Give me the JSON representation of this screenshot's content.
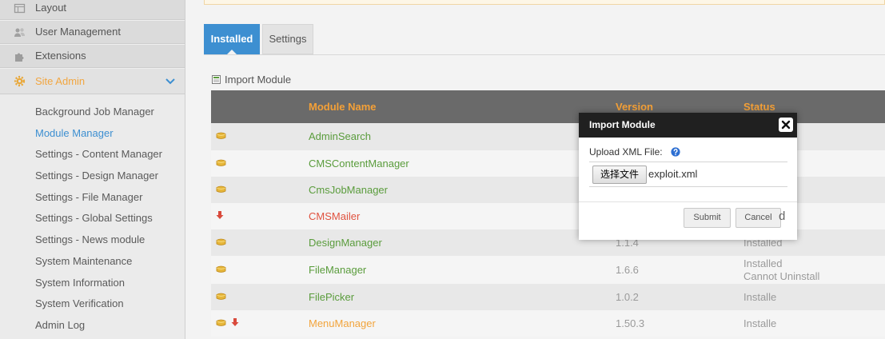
{
  "sidebar": {
    "nav": [
      {
        "label": "Layout",
        "icon": "layout-icon"
      },
      {
        "label": "User Management",
        "icon": "users-icon"
      },
      {
        "label": "Extensions",
        "icon": "puzzle-icon"
      },
      {
        "label": "Site Admin",
        "icon": "gear-icon",
        "expanded": true
      }
    ],
    "submenu": [
      {
        "label": "Background Job Manager",
        "active": false
      },
      {
        "label": "Module Manager",
        "active": true
      },
      {
        "label": "Settings - Content Manager",
        "active": false
      },
      {
        "label": "Settings - Design Manager",
        "active": false
      },
      {
        "label": "Settings - File Manager",
        "active": false
      },
      {
        "label": "Settings - Global Settings",
        "active": false
      },
      {
        "label": "Settings - News module",
        "active": false
      },
      {
        "label": "System Maintenance",
        "active": false
      },
      {
        "label": "System Information",
        "active": false
      },
      {
        "label": "System Verification",
        "active": false
      },
      {
        "label": "Admin Log",
        "active": false
      }
    ]
  },
  "tabs": [
    {
      "label": "Installed",
      "active": true
    },
    {
      "label": "Settings",
      "active": false
    }
  ],
  "import_link": {
    "label": "Import Module",
    "icon": "import-icon"
  },
  "table": {
    "headers": {
      "name": "Module Name",
      "version": "Version",
      "status": "Status"
    },
    "rows": [
      {
        "icons": [
          "package-icon"
        ],
        "name": "AdminSearch",
        "name_color": "#5a9c3c"
      },
      {
        "icons": [
          "package-icon"
        ],
        "name": "CMSContentManager",
        "name_color": "#5a9c3c"
      },
      {
        "icons": [
          "package-icon"
        ],
        "name": "CmsJobManager",
        "name_color": "#5a9c3c"
      },
      {
        "icons": [
          "down-arrow-icon"
        ],
        "name": "CMSMailer",
        "name_color": "#e0523f",
        "status": [
          "d"
        ]
      },
      {
        "icons": [
          "package-icon"
        ],
        "name": "DesignManager",
        "name_color": "#5a9c3c",
        "version": "1.1.4",
        "status": [
          "Installed"
        ]
      },
      {
        "icons": [
          "package-icon"
        ],
        "name": "FileManager",
        "name_color": "#5a9c3c",
        "version": "1.6.6",
        "status": [
          "Installed",
          "Cannot Uninstall"
        ]
      },
      {
        "icons": [
          "package-icon"
        ],
        "name": "FilePicker",
        "name_color": "#5a9c3c",
        "version": "1.0.2",
        "status": [
          "Installe"
        ]
      },
      {
        "icons": [
          "package-icon",
          "down-arrow-icon"
        ],
        "name": "MenuManager",
        "name_color": "#f2a43c",
        "version": "1.50.3",
        "status": [
          "Installe"
        ]
      }
    ]
  },
  "modal": {
    "title": "Import Module",
    "field_label": "Upload XML File:",
    "file_button": "选择文件",
    "file_name": "exploit.xml",
    "submit": "Submit",
    "cancel": "Cancel"
  },
  "colors": {
    "accent": "#3d8fd1",
    "header_bg": "#6a6a6a",
    "header_text": "#f4a037",
    "modal_title_bg": "#202020",
    "notice_bg": "#fdf6e6",
    "site_admin": "#f2a640"
  }
}
